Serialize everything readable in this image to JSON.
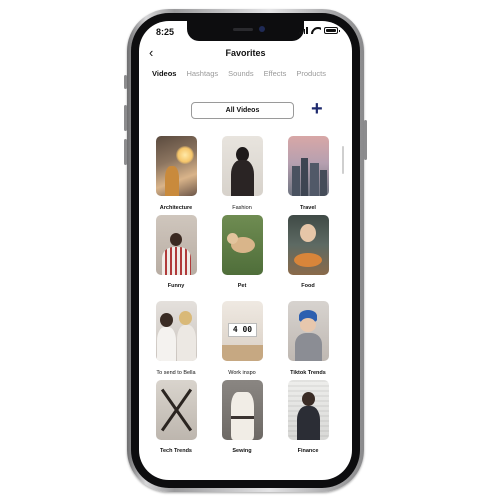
{
  "status_bar": {
    "time": "8:25"
  },
  "header": {
    "title": "Favorites",
    "back_icon": "chevron-left-icon"
  },
  "tabs": [
    {
      "label": "Videos",
      "active": true
    },
    {
      "label": "Hashtags",
      "active": false
    },
    {
      "label": "Sounds",
      "active": false
    },
    {
      "label": "Effects",
      "active": false
    },
    {
      "label": "Products",
      "active": false
    }
  ],
  "filter": {
    "label": "All Videos",
    "add_icon": "plus-icon"
  },
  "collections": [
    {
      "label": "Architecture"
    },
    {
      "label": "Fashion"
    },
    {
      "label": "Travel"
    },
    {
      "label": "Funny"
    },
    {
      "label": "Pet"
    },
    {
      "label": "Food"
    },
    {
      "label": "To send to Bella"
    },
    {
      "label": "Work inspo"
    },
    {
      "label": "Tiktok Trends"
    },
    {
      "label": "Tech Trends"
    },
    {
      "label": "Sewing"
    },
    {
      "label": "Finance"
    }
  ],
  "work_inspo_clock": "4 00",
  "colors": {
    "accent": "#1e2a6e",
    "inactive_tab": "#9a9a9a"
  }
}
